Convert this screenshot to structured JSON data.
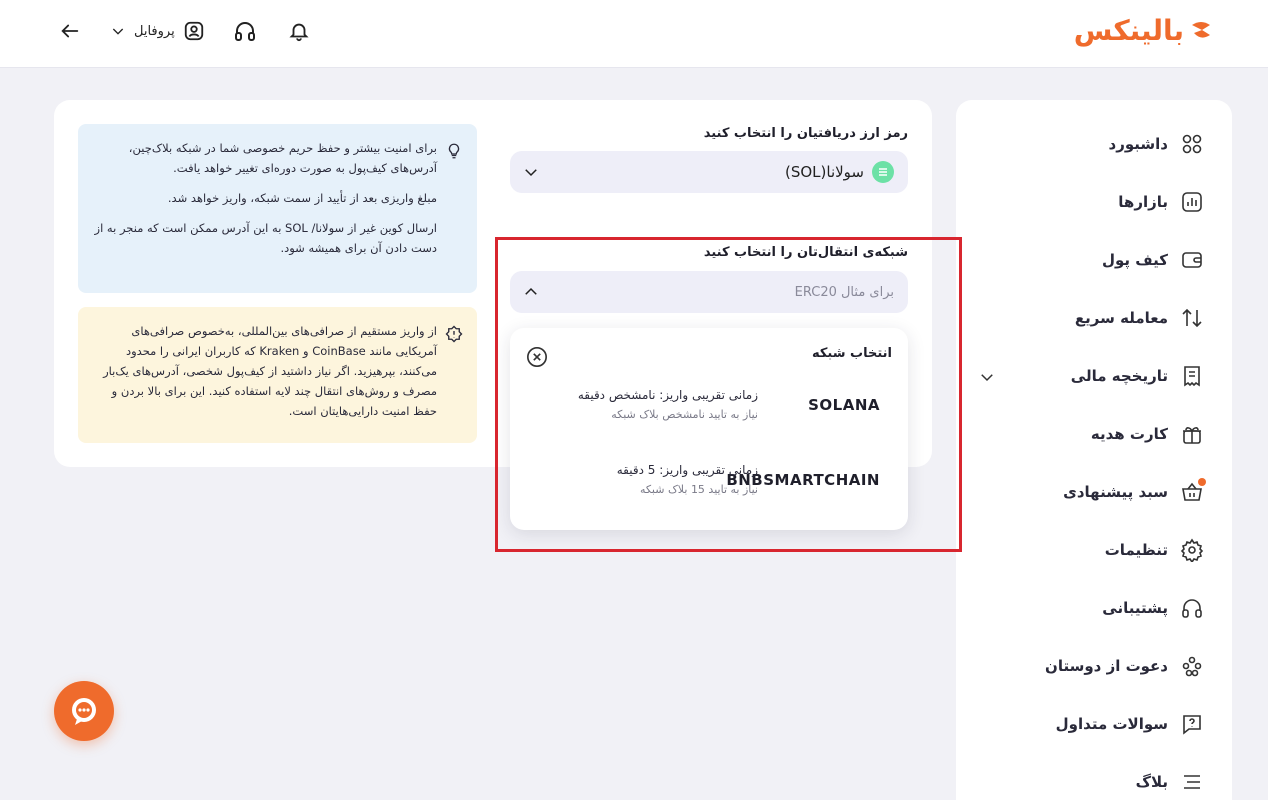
{
  "header": {
    "logo_text": "بالینکس",
    "profile_label": "پروفایل"
  },
  "sidebar": {
    "items": [
      {
        "label": "داشبورد",
        "icon": "grid-icon"
      },
      {
        "label": "بازارها",
        "icon": "chart-bars-icon"
      },
      {
        "label": "کیف پول",
        "icon": "wallet-icon"
      },
      {
        "label": "معامله سریع",
        "icon": "swap-icon"
      },
      {
        "label": "تاریخچه مالی",
        "icon": "receipt-icon"
      },
      {
        "label": "کارت هدیه",
        "icon": "gift-icon"
      },
      {
        "label": "سبد پیشنهادی",
        "icon": "basket-icon"
      },
      {
        "label": "تنظیمات",
        "icon": "gear-icon"
      },
      {
        "label": "پشتیبانی",
        "icon": "headphones-icon"
      },
      {
        "label": "دعوت از دوستان",
        "icon": "users-icon"
      },
      {
        "label": "سوالات متداول",
        "icon": "question-icon"
      },
      {
        "label": "بلاگ",
        "icon": "menu-lines-icon"
      }
    ]
  },
  "deposit": {
    "coin_title": "رمز ارز دریافتیان را انتخاب کنید",
    "coin_selected": "سولانا(SOL)",
    "network_title": "شبکه‌ی انتقال‌تان را انتخاب کنید",
    "network_placeholder": "برای مثال ERC20"
  },
  "network_dropdown": {
    "title": "انتخاب شبکه",
    "networks": [
      {
        "name": "SOLANA",
        "time": "زمانی تقریبی واریز: نامشخص دقیقه",
        "confirm": "نیاز به تایید نامشخص بلاک شبکه"
      },
      {
        "name": "BNBSMARTCHAIN",
        "time": "زمانی تقریبی واریز: 5 دقیقه",
        "confirm": "نیاز به تایید 15 بلاک شبکه"
      }
    ]
  },
  "info": {
    "blue": [
      "برای امنیت بیشتر و حفظ حریم خصوصی شما در شبکه بلاک‌چین، آدرس‌های کیف‌پول به صورت دوره‌ای تغییر خواهد یافت.",
      "مبلغ واریزی بعد از تأیید از سمت شبکه، واریز خواهد شد.",
      "ارسال کوین غیر از سولانا/ SOL به این آدرس ممکن است که منجر به از دست دادن آن برای همیشه شود."
    ],
    "yellow": "از واریز مستقیم از صرافی‌های بین‌المللی، به‌خصوص صرافی‌های آمریکایی مانند CoinBase و Kraken که کاربران ایرانی را محدود می‌کنند، بپرهیزید. اگر نیاز داشتید از کیف‌پول شخصی، آدرس‌های یک‌بار مصرف و روش‌های انتقال چند لایه استفاده کنید. این برای بالا بردن و حفظ امنیت دارایی‌هایتان است."
  },
  "colors": {
    "accent": "#ef6b2c",
    "highlight": "#d8262f",
    "info_blue": "#e6f1fa",
    "info_yellow": "#fdf5dd"
  }
}
